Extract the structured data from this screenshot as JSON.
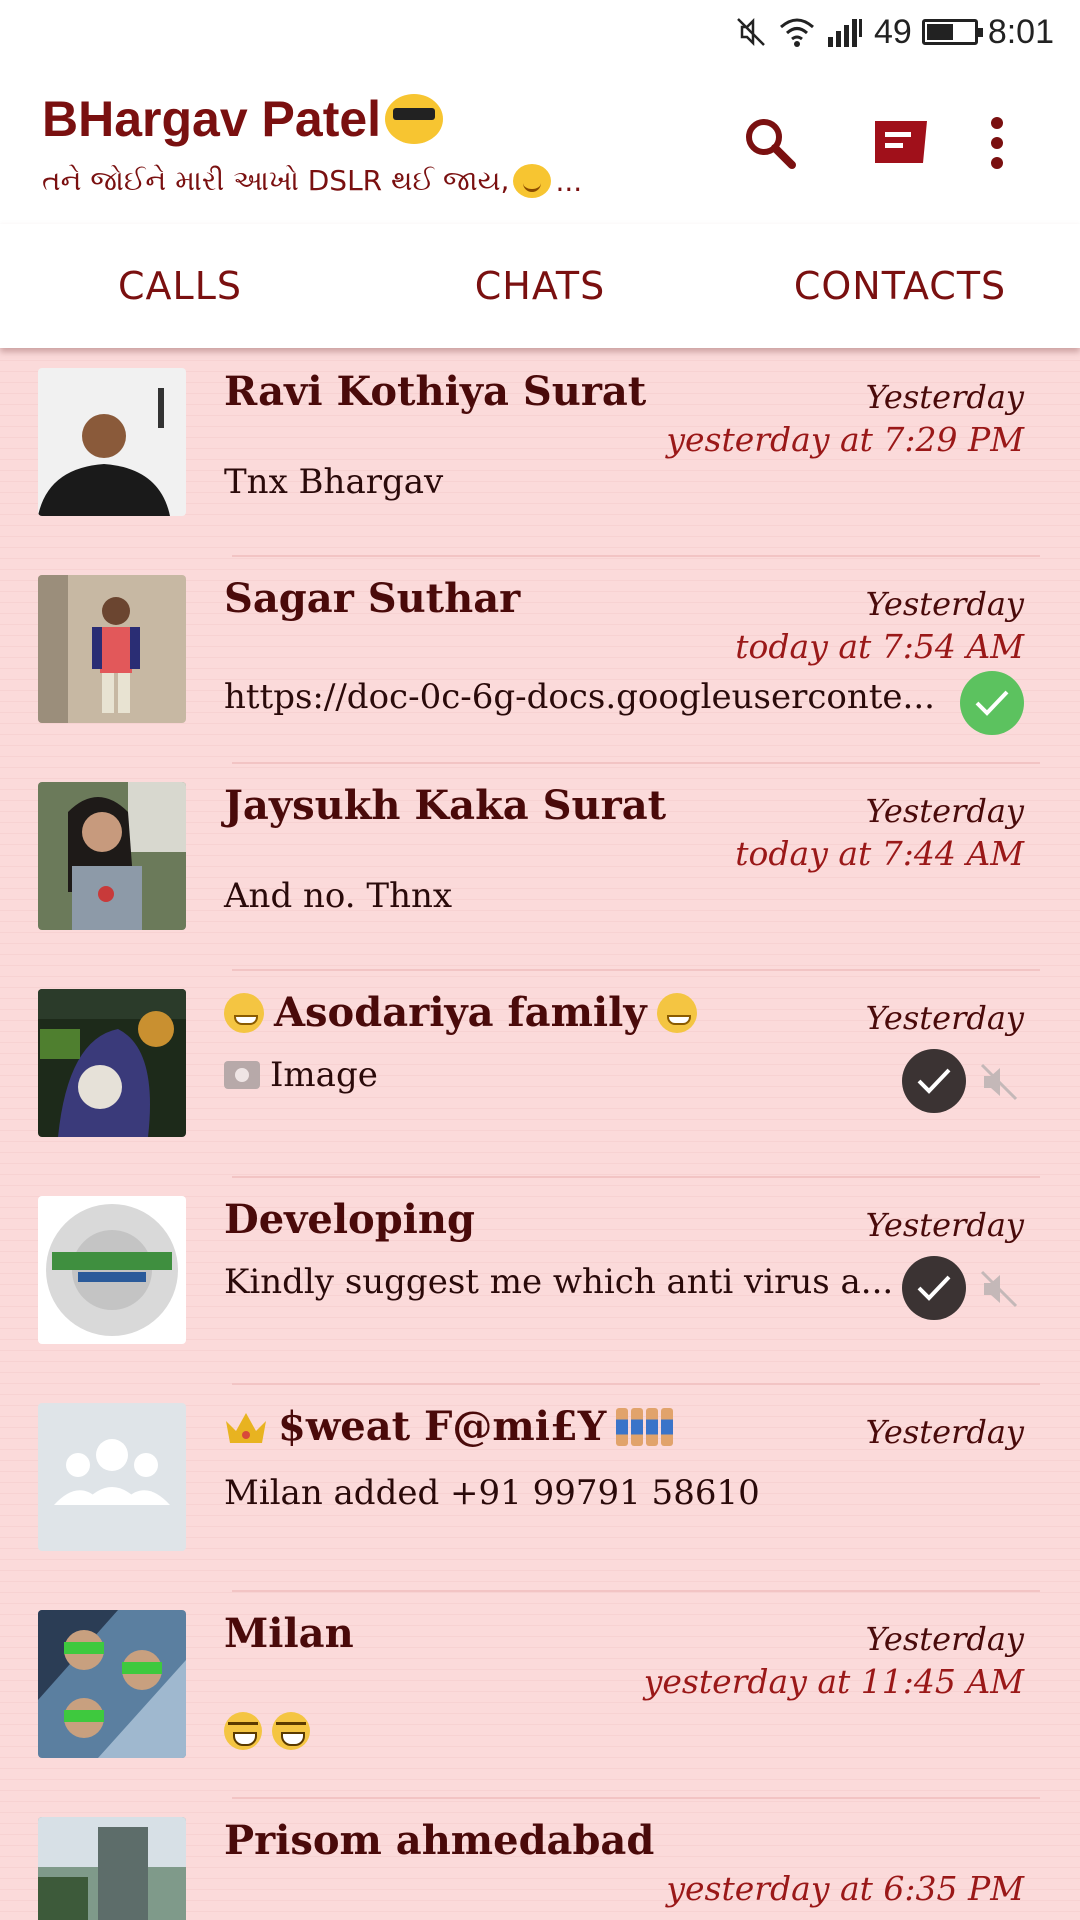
{
  "status_bar": {
    "battery_level": "49",
    "time": "8:01",
    "icons": [
      "mute-icon",
      "wifi-icon",
      "signal-icon",
      "battery-icon"
    ]
  },
  "header": {
    "title": "BHargav Patel",
    "status_text": "તને જોઈને મારી આખો DSLR  થઈ જાય,",
    "status_suffix": "...",
    "icons": [
      "search-icon",
      "new-chat-icon",
      "more-vert-icon"
    ]
  },
  "tabs": [
    {
      "label": "CALLS",
      "active": false
    },
    {
      "label": "CHATS",
      "active": true
    },
    {
      "label": "CONTACTS",
      "active": false
    }
  ],
  "chats": [
    {
      "name": "Ravi Kothiya Surat",
      "date": "Yesterday",
      "seen": "yesterday at 7:29 PM",
      "message": "Tnx Bhargav"
    },
    {
      "name": "Sagar Suthar",
      "date": "Yesterday",
      "seen": "today at 7:54 AM",
      "message": "https://doc-0c-6g-docs.googleuserconte..."
    },
    {
      "name": "Jaysukh Kaka Surat",
      "date": "Yesterday",
      "seen": "today at 7:44 AM",
      "message": "And no. Thnx"
    },
    {
      "name": "Asodariya family",
      "date": "Yesterday",
      "seen": "",
      "message": "Image"
    },
    {
      "name": "Developing",
      "date": "Yesterday",
      "seen": "",
      "message": "Kindly suggest me which anti virus a..."
    },
    {
      "name": "$weat F@mi£Y",
      "date": "Yesterday",
      "seen": "",
      "message": "Milan added +91 99791 58610"
    },
    {
      "name": "Milan",
      "date": "Yesterday",
      "seen": "yesterday at 11:45 AM",
      "message": ""
    },
    {
      "name": "Prisom ahmedabad",
      "date": "",
      "seen": "yesterday at 6:35 PM",
      "message": ""
    }
  ],
  "colors": {
    "accent": "#7a1010",
    "list_background": "#fbdada",
    "seen_text": "#9a1818",
    "tick_green": "#5cc25f"
  }
}
